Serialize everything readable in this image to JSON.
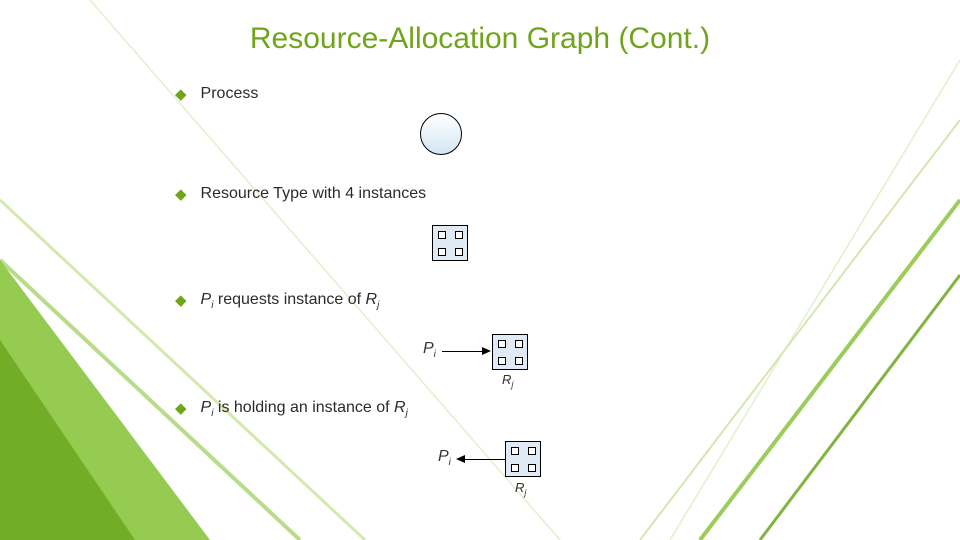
{
  "title": "Resource-Allocation Graph (Cont.)",
  "bullets": {
    "b1": "Process",
    "b2": "Resource Type with 4 instances",
    "b3_prefix_var": "P",
    "b3_prefix_sub": "i",
    "b3_mid": " requests instance of ",
    "b3_suffix_var": "R",
    "b3_suffix_sub": "j",
    "b4_prefix_var": "P",
    "b4_prefix_sub": "i",
    "b4_mid": " is holding an instance of ",
    "b4_suffix_var": "R",
    "b4_suffix_sub": "j"
  },
  "labels": {
    "Pi_var": "P",
    "Pi_sub": "i",
    "Rj_var": "R",
    "Rj_sub": "j"
  },
  "colors": {
    "accent": "#6fa51a"
  }
}
